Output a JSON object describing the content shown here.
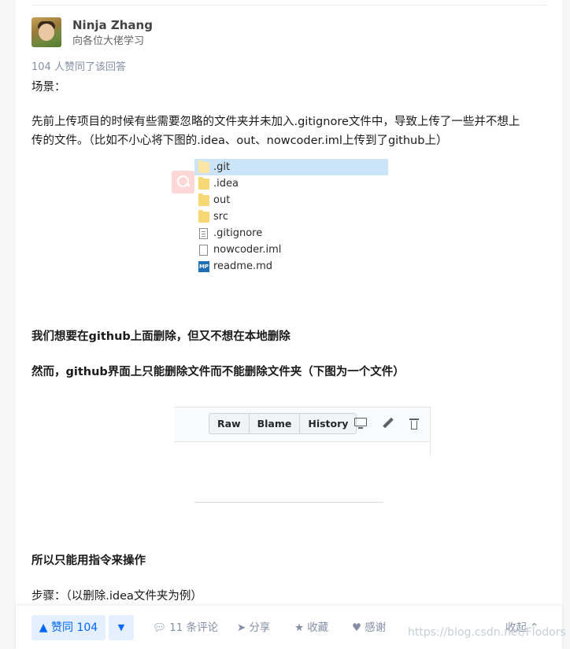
{
  "author": {
    "name": "Ninja Zhang",
    "bio": "向各位大佬学习"
  },
  "votes_line": "104 人赞同了该回答",
  "paragraphs": {
    "scene": "场景：",
    "desc_line1": "先前上传项目的时候有些需要忽略的文件夹并未加入.gitignore文件中，导致上传了一些并不想上",
    "desc_line2": "传的文件。（比如不小心将下图的.idea、out、nowcoder.iml上传到了github上）",
    "want": "我们想要在github上面删除，但又不想在本地删除",
    "however": "然而，github界面上只能删除文件而不能删除文件夹（下图为一个文件）",
    "so": "所以只能用指令来操作",
    "steps": "步骤：（以删除.idea文件夹为例）"
  },
  "file_list": [
    {
      "name": ".git",
      "type": "folder-light",
      "selected": true
    },
    {
      "name": ".idea",
      "type": "folder"
    },
    {
      "name": "out",
      "type": "folder"
    },
    {
      "name": "src",
      "type": "folder"
    },
    {
      "name": ".gitignore",
      "type": "text-file"
    },
    {
      "name": "nowcoder.iml",
      "type": "file"
    },
    {
      "name": "readme.md",
      "type": "markdown",
      "icon_text": "MP"
    }
  ],
  "github_toolbar": {
    "raw": "Raw",
    "blame": "Blame",
    "history": "History",
    "icons": [
      "monitor-icon",
      "pencil-icon",
      "trash-icon"
    ]
  },
  "actions": {
    "vote_up": "▲ 赞同 104",
    "vote_down": "▼",
    "comments": "11 条评论",
    "share": "分享",
    "favorite": "收藏",
    "thanks": "感谢",
    "collapse": "收起"
  },
  "watermark": "https://blog.csdn.net/Flodors",
  "colors": {
    "accent": "#0066ff",
    "accent_bg": "#e5f0ff",
    "meta": "#8590a6",
    "selection": "#cce4f7",
    "folder": "#f8d775"
  }
}
